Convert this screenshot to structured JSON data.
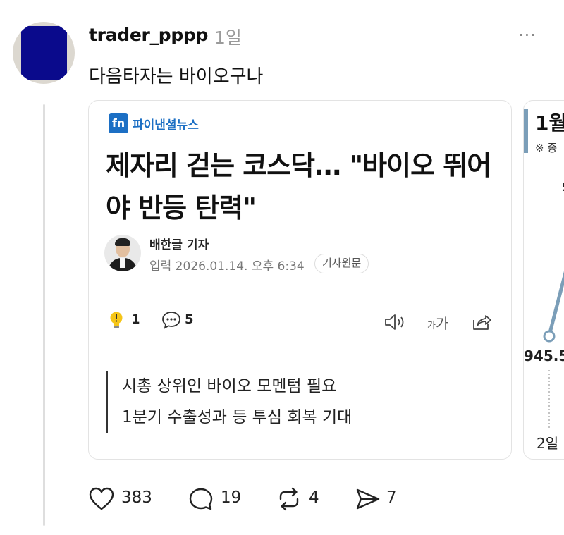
{
  "post": {
    "username": "trader_pppp",
    "time": "1일",
    "more": "···",
    "text": "다음타자는 바이오구나"
  },
  "article": {
    "publisher": "파이낸셜뉴스",
    "publisher_logo": "fn",
    "headline": "제자리 걷는 코스닥… \"바이오 뛰어야 반등 탄력\"",
    "reporter": "배한글 기자",
    "published": "입력 2026.01.14. 오후 6:34",
    "source_button": "기사원문",
    "like_count": "1",
    "comment_count": "5",
    "font_size_label_small": "가",
    "font_size_label": "가",
    "summary": [
      "시총 상위인 바이오 모멘텀 필요",
      "1분기 수출성과 등 투심 회복 기대"
    ]
  },
  "second_card": {
    "title": "1월",
    "note": "※ 종",
    "top_value": "9",
    "value": "945.5",
    "axis_label": "2일"
  },
  "actions": {
    "likes": "383",
    "replies": "19",
    "reposts": "4",
    "shares": "7"
  },
  "colors": {
    "accent": "#1c6fc4",
    "chart_line": "#7b9eb8",
    "avatar": "#0a0a8c"
  }
}
